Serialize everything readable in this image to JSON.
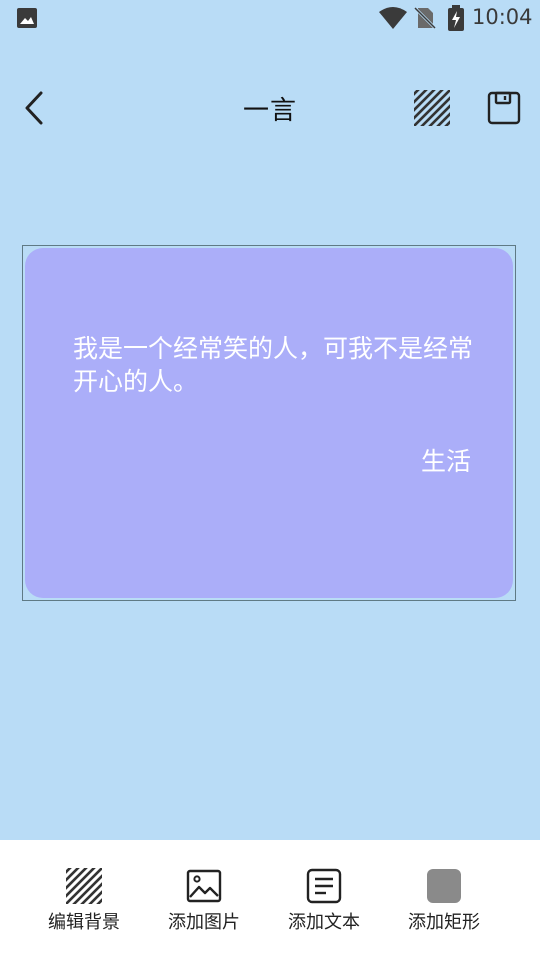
{
  "status_bar": {
    "time": "10:04"
  },
  "header": {
    "title": "一言"
  },
  "quote": {
    "text": "我是一个经常笑的人，可我不是经常开心的人。",
    "author": "生活",
    "card_color": "#ABAEF9"
  },
  "toolbar": {
    "items": [
      {
        "label": "编辑背景",
        "icon": "stripes-icon"
      },
      {
        "label": "添加图片",
        "icon": "image-icon"
      },
      {
        "label": "添加文本",
        "icon": "text-document-icon"
      },
      {
        "label": "添加矩形",
        "icon": "rectangle-icon"
      }
    ]
  },
  "colors": {
    "background": "#B9DCF6",
    "toolbar_background": "#FFFFFF",
    "rectangle_swatch": "#8A8A8A"
  }
}
